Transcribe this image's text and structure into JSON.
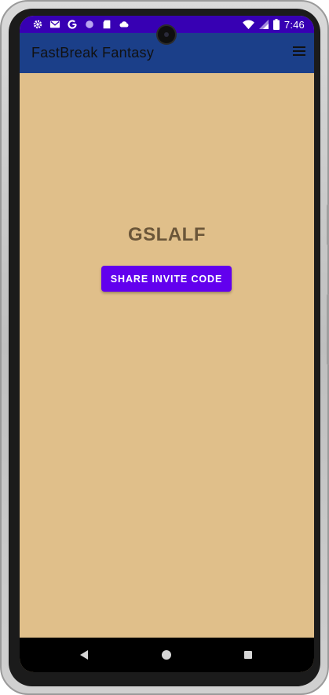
{
  "status_bar": {
    "time": "7:46",
    "left_icons": [
      "settings-icon",
      "gmail-icon",
      "google-icon",
      "circle-icon",
      "sd-card-icon",
      "cloud-icon"
    ],
    "right_icons": [
      "wifi-icon",
      "signal-icon",
      "battery-icon"
    ],
    "background": "#3700b3"
  },
  "app_bar": {
    "title": "FastBreak Fantasy",
    "menu_icon": "hamburger-menu-icon",
    "background": "#1b3f89"
  },
  "main": {
    "invite_code": "GSLALF",
    "share_button_label": "SHARE INVITE CODE",
    "background": "#e0bf8a",
    "button_color": "#6200ee"
  },
  "nav_bar": {
    "buttons": [
      "back-icon",
      "home-icon",
      "recents-icon"
    ]
  }
}
